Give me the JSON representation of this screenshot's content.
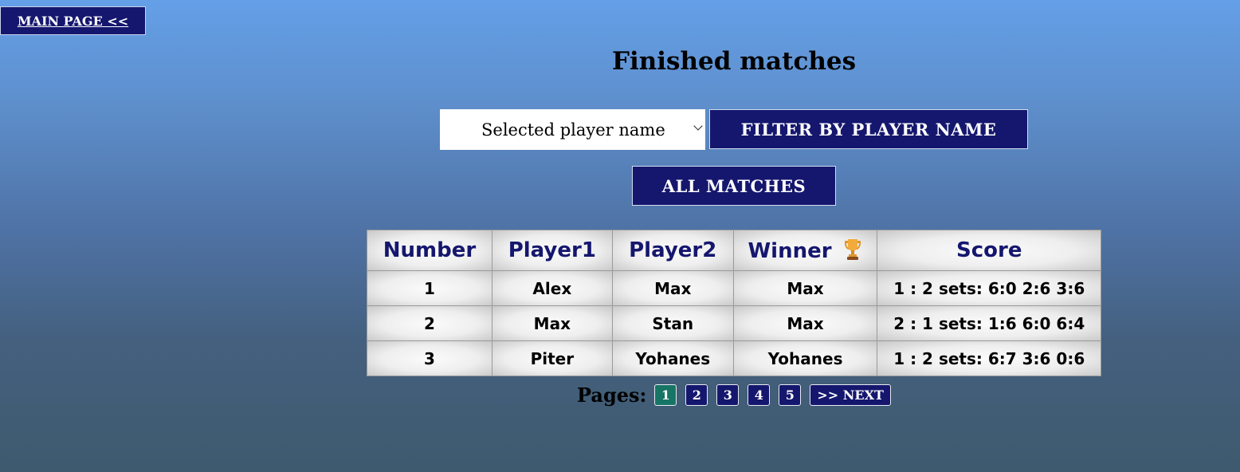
{
  "nav": {
    "main_page_label": "MAIN PAGE <<"
  },
  "page": {
    "title": "Finished matches"
  },
  "filter": {
    "selected_player": "Selected player name",
    "filter_button_label": "FILTER BY PLAYER NAME",
    "all_matches_label": "ALL MATCHES"
  },
  "table": {
    "headers": {
      "number": "Number",
      "player1": "Player1",
      "player2": "Player2",
      "winner": "Winner",
      "score": "Score"
    },
    "winner_icon": "trophy-icon",
    "rows": [
      {
        "number": "1",
        "player1": "Alex",
        "player2": "Max",
        "winner": "Max",
        "score": "1 : 2 sets: 6:0 2:6 3:6"
      },
      {
        "number": "2",
        "player1": "Max",
        "player2": "Stan",
        "winner": "Max",
        "score": "2 : 1 sets: 1:6 6:0 6:4"
      },
      {
        "number": "3",
        "player1": "Piter",
        "player2": "Yohanes",
        "winner": "Yohanes",
        "score": "1 : 2 sets: 6:7 3:6 0:6"
      }
    ]
  },
  "pagination": {
    "label": "Pages:",
    "pages": [
      "1",
      "2",
      "3",
      "4",
      "5"
    ],
    "current_page": "1",
    "next_label": ">> NEXT"
  },
  "colors": {
    "button_navy": "#15176e",
    "active_page": "#177566",
    "header_text": "#15176e"
  }
}
